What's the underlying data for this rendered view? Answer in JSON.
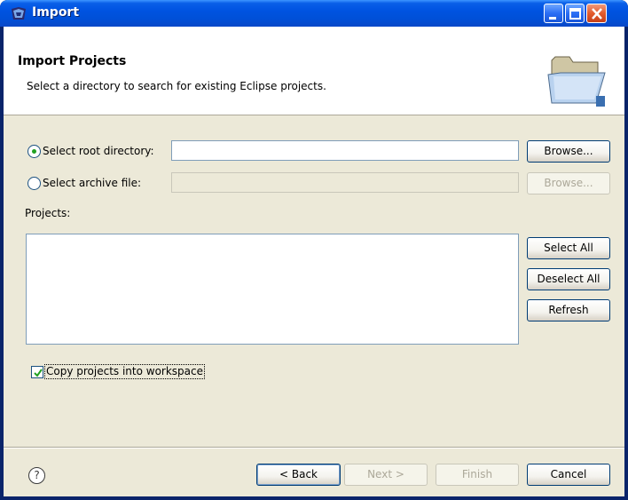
{
  "window": {
    "title": "Import",
    "icon": "eclipse-import-icon"
  },
  "titlebar_buttons": {
    "minimize": "minimize-icon",
    "maximize": "maximize-icon",
    "close": "close-icon"
  },
  "banner": {
    "title": "Import Projects",
    "subtitle": "Select a directory to search for existing Eclipse projects.",
    "icon": "folder-icon"
  },
  "source": {
    "root_directory": {
      "label": "Select root directory:",
      "selected": true,
      "value": "",
      "browse_label": "Browse..."
    },
    "archive_file": {
      "label": "Select archive file:",
      "selected": false,
      "value": "",
      "browse_label": "Browse..."
    }
  },
  "projects": {
    "label": "Projects:",
    "items": [],
    "select_all_label": "Select All",
    "deselect_all_label": "Deselect All",
    "refresh_label": "Refresh"
  },
  "copy_projects": {
    "label": "Copy projects into workspace",
    "checked": true
  },
  "footer": {
    "help_icon": "help-icon",
    "back_label": "< Back",
    "next_label": "Next >",
    "finish_label": "Finish",
    "cancel_label": "Cancel"
  },
  "colors": {
    "titlebar": "#0053e1",
    "dialog": "#ece9d8",
    "radio_dot": "#21a121"
  }
}
